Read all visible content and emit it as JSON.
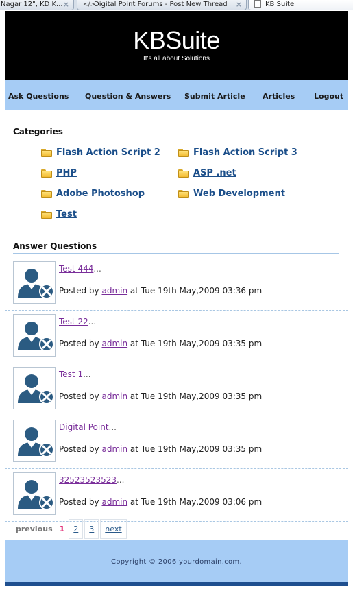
{
  "browser": {
    "tabs": [
      {
        "label": "Nagar 12\", KD K..."
      },
      {
        "label": "Digital Point Forums - Post New Thread"
      },
      {
        "label": "KB Suite"
      }
    ]
  },
  "header": {
    "logo": "KBSuite",
    "tagline": "It's all about Solutions"
  },
  "nav": {
    "items": [
      {
        "label": "Ask Questions"
      },
      {
        "label": "Question & Answers"
      },
      {
        "label": "Submit Article"
      },
      {
        "label": "Articles"
      },
      {
        "label": "Logout"
      }
    ]
  },
  "categories": {
    "title": "Categories",
    "items": [
      {
        "label": "Flash Action Script 2"
      },
      {
        "label": "Flash Action Script 3"
      },
      {
        "label": "PHP"
      },
      {
        "label": "ASP .net"
      },
      {
        "label": "Adobe Photoshop"
      },
      {
        "label": "Web Development"
      },
      {
        "label": "Test"
      }
    ]
  },
  "answers": {
    "title": "Answer Questions",
    "posted_by": "Posted by",
    "at": "at",
    "ellipsis": "...",
    "items": [
      {
        "title": "Test 444",
        "author": "admin",
        "date": "Tue 19th May,2009 03:36 pm"
      },
      {
        "title": "Test 22",
        "author": "admin",
        "date": "Tue 19th May,2009 03:35 pm"
      },
      {
        "title": "Test 1",
        "author": "admin",
        "date": "Tue 19th May,2009 03:35 pm"
      },
      {
        "title": "Digital Point",
        "author": "admin",
        "date": "Tue 19th May,2009 03:35 pm"
      },
      {
        "title": "32523523523",
        "author": "admin",
        "date": "Tue 19th May,2009 03:06 pm"
      }
    ]
  },
  "pagination": {
    "previous": "previous",
    "current": "1",
    "pages": [
      "2",
      "3"
    ],
    "next": "next"
  },
  "footer": {
    "copyright": "Copyright © 2006 yourdomain.com."
  },
  "colors": {
    "header_bg": "#000000",
    "nav_bg": "#a6ccf5",
    "link": "#1c4f8a",
    "visited_link": "#7a2e9a",
    "accent_bar": "#1e4f8f"
  }
}
